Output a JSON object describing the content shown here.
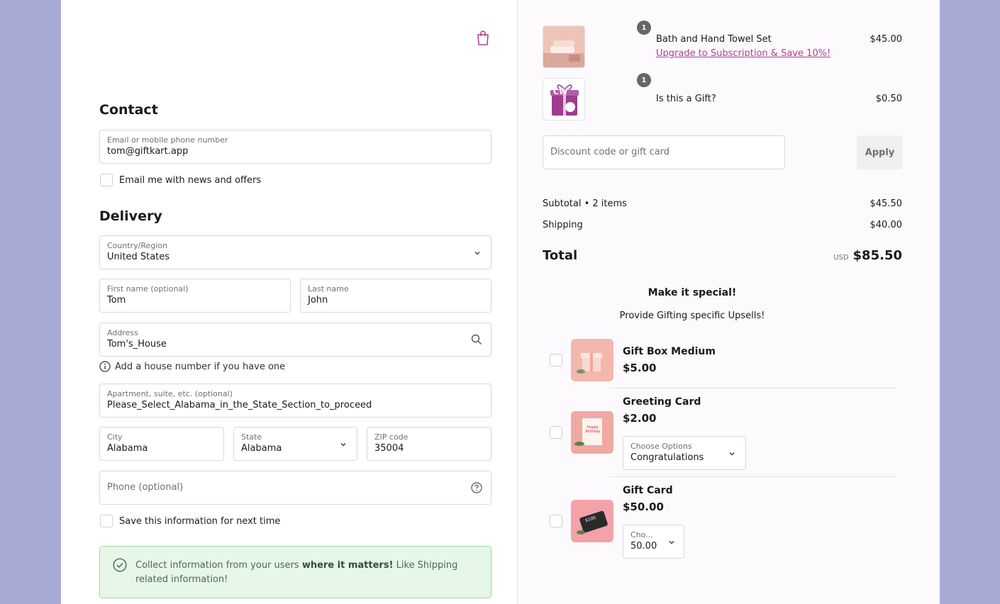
{
  "contact": {
    "heading": "Contact",
    "email_label": "Email or mobile phone number",
    "email_value": "tom@giftkart.app",
    "newsletter_label": "Email me with news and offers"
  },
  "delivery": {
    "heading": "Delivery",
    "country_label": "Country/Region",
    "country_value": "United States",
    "first_name_label": "First name (optional)",
    "first_name_value": "Tom",
    "last_name_label": "Last name",
    "last_name_value": "John",
    "address_label": "Address",
    "address_value": "Tom's_House",
    "address_hint": "Add a house number if you have one",
    "apartment_label": "Apartment, suite, etc. (optional)",
    "apartment_value": "Please_Select_Alabama_in_the_State_Section_to_proceed",
    "city_label": "City",
    "city_value": "Alabama",
    "state_label": "State",
    "state_value": "Alabama",
    "zip_label": "ZIP code",
    "zip_value": "35004",
    "phone_placeholder": "Phone (optional)",
    "save_info_label": "Save this information for next time"
  },
  "notice": {
    "text_before": "Collect information from your users ",
    "text_bold": "where it matters!",
    "text_after": " Like Shipping related information!"
  },
  "cart": {
    "items": [
      {
        "qty": "1",
        "name": "Bath and Hand Towel Set",
        "link": "Upgrade to Subscription & Save 10%!",
        "price": "$45.00"
      },
      {
        "qty": "1",
        "name": "Is this a Gift?",
        "thumb_text": "CW",
        "price": "$0.50"
      }
    ],
    "discount_placeholder": "Discount code or gift card",
    "apply_label": "Apply",
    "subtotal_label": "Subtotal • 2 items",
    "subtotal_value": "$45.50",
    "shipping_label": "Shipping",
    "shipping_value": "$40.00",
    "total_label": "Total",
    "currency": "USD",
    "total_value": "$85.50"
  },
  "upsells": {
    "title": "Make it special!",
    "subtitle": "Provide Gifting specific Upsells!",
    "items": [
      {
        "name": "Gift Box Medium",
        "price": "$5.00"
      },
      {
        "name": "Greeting Card",
        "price": "$2.00",
        "option_label": "Choose Options",
        "option_value": "Congratulations",
        "card_text": "Happy Birthday"
      },
      {
        "name": "Gift Card",
        "price": "$50.00",
        "option_label": "Cho...",
        "option_value": "50.00",
        "card_text": "$100"
      }
    ]
  },
  "colors": {
    "brand": "#b1418f",
    "background": "#a8a9d4",
    "notice_bg": "#e6f6e8",
    "notice_border": "#9fd8a8"
  }
}
